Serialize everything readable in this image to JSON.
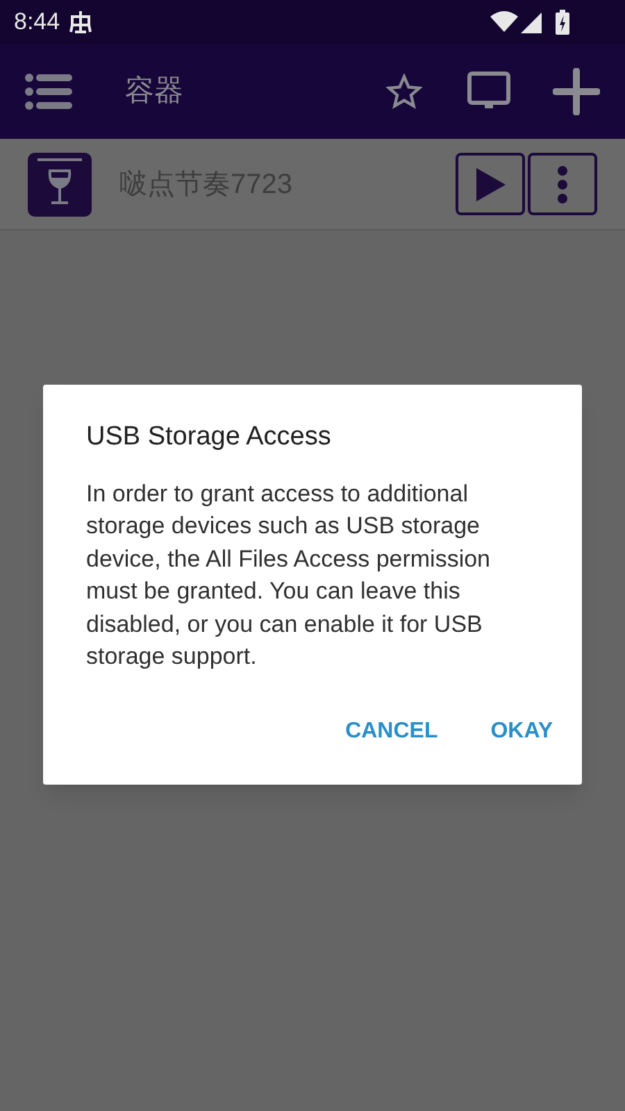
{
  "status_bar": {
    "time": "8:44"
  },
  "app_bar": {
    "title": "容器"
  },
  "containers": [
    {
      "name": "啵点节奏7723"
    }
  ],
  "dialog": {
    "title": "USB Storage Access",
    "message": "In order to grant access to additional storage devices such as USB storage device, the All Files Access permission must be granted. You can leave this disabled, or you can enable it for USB storage support.",
    "buttons": [
      "CANCEL",
      "OKAY"
    ]
  }
}
